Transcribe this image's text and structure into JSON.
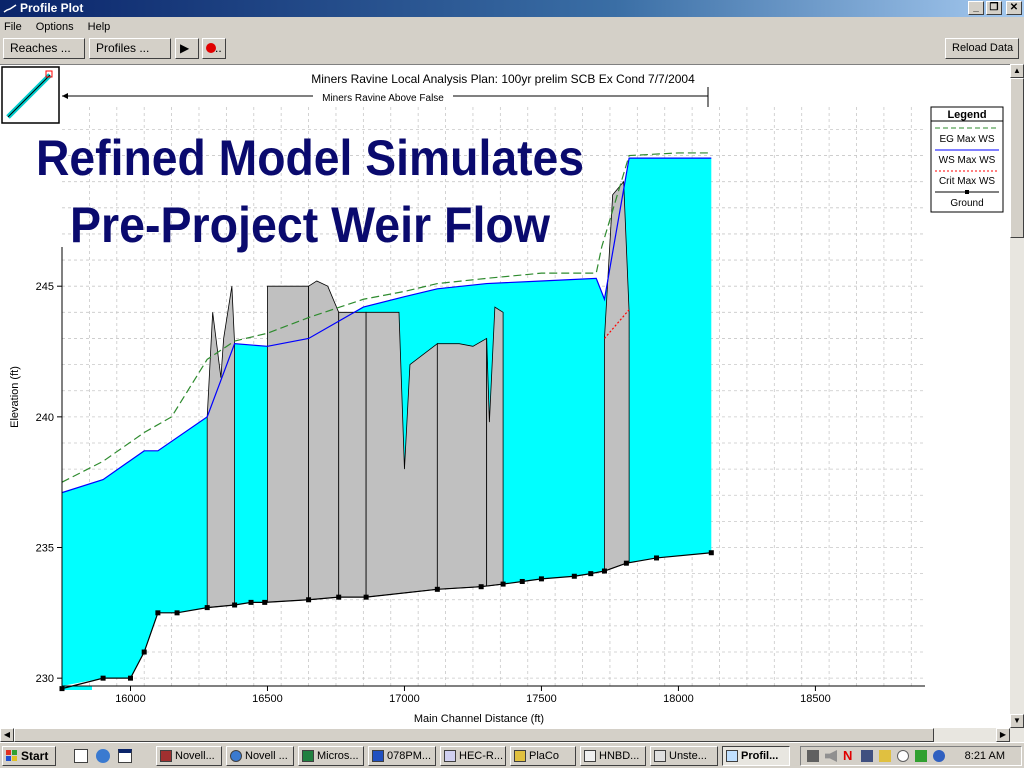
{
  "window": {
    "title": "Profile Plot",
    "minimize_glyph": "_",
    "maximize_glyph": "❐",
    "close_glyph": "✕"
  },
  "menu": {
    "items": [
      "File",
      "Options",
      "Help"
    ]
  },
  "toolbar": {
    "reaches_label": "Reaches ...",
    "profiles_label": "Profiles ...",
    "play_glyph": "▶",
    "more_glyph": "..",
    "reload_label": "Reload Data"
  },
  "plot": {
    "header": "Miners Ravine Local Analysis       Plan: 100yr prelim SCB Ex Cond     7/7/2004",
    "reach_label": "Miners Ravine Above False",
    "overlay_line1": "Refined Model Simulates",
    "overlay_line2": "Pre-Project Weir Flow",
    "overlay_color": "#0a0a6e",
    "water_color": "#00ffff",
    "structure_color": "#c0c0c0"
  },
  "chart_data": {
    "type": "area",
    "xlabel": "Main Channel Distance (ft)",
    "ylabel": "Elevation (ft)",
    "xlim": [
      15750,
      18900
    ],
    "ylim": [
      229.7,
      246.5
    ],
    "x_ticks": [
      16000,
      16500,
      17000,
      17500,
      18000,
      18500
    ],
    "y_ticks": [
      230,
      235,
      240,
      245
    ],
    "grid": true,
    "legend_position": "top-right",
    "legend": {
      "title": "Legend",
      "entries": [
        "EG  Max WS",
        "WS  Max WS",
        "Crit  Max WS",
        "Ground"
      ]
    },
    "series": [
      {
        "name": "EG  Max WS",
        "color": "#2e8b2e",
        "x": [
          15750,
          15900,
          16050,
          16150,
          16280,
          16380,
          16500,
          16650,
          16850,
          17000,
          17120,
          17300,
          17500,
          17700,
          17720,
          17820,
          18000,
          18120
        ],
        "y": [
          237.5,
          238.3,
          239.4,
          240.0,
          242.2,
          242.9,
          243.2,
          243.8,
          244.5,
          244.8,
          245.1,
          245.3,
          245.5,
          245.5,
          246.5,
          250.0,
          250.1,
          250.1
        ]
      },
      {
        "name": "WS  Max WS",
        "color": "#0000ff",
        "x": [
          15750,
          15900,
          16050,
          16100,
          16280,
          16380,
          16500,
          16650,
          16850,
          17000,
          17120,
          17300,
          17500,
          17700,
          17730,
          17820,
          18000,
          18120
        ],
        "y": [
          237.1,
          237.6,
          238.7,
          238.7,
          240.0,
          242.8,
          242.7,
          243.0,
          244.2,
          244.6,
          244.9,
          245.1,
          245.2,
          245.3,
          244.5,
          249.9,
          249.9,
          249.9
        ]
      },
      {
        "name": "Crit  Max WS",
        "color": "#ff0000",
        "x": [
          17730,
          17820
        ],
        "y": [
          243.0,
          244.1
        ]
      },
      {
        "name": "Ground",
        "color": "#000000",
        "x": [
          15750,
          15900,
          16000,
          16050,
          16100,
          16170,
          16280,
          16380,
          16440,
          16490,
          16650,
          16760,
          16860,
          17120,
          17280,
          17360,
          17430,
          17500,
          17620,
          17680,
          17730,
          17810,
          17920,
          18120
        ],
        "y": [
          229.6,
          230.0,
          230.0,
          231.0,
          232.5,
          232.5,
          232.7,
          232.8,
          232.9,
          232.9,
          233.0,
          233.1,
          233.1,
          233.4,
          233.5,
          233.6,
          233.7,
          233.8,
          233.9,
          234.0,
          234.1,
          234.4,
          234.6,
          234.8
        ]
      }
    ],
    "structures": [
      {
        "x": [
          16280,
          16300,
          16330,
          16340,
          16370,
          16380
        ],
        "top": [
          240.0,
          244.0,
          241.5,
          243.0,
          245.0,
          242.8
        ]
      },
      {
        "x": [
          16500,
          16650
        ],
        "top": [
          245.0,
          245.0
        ]
      },
      {
        "x": [
          16650,
          16680,
          16720,
          16760
        ],
        "top": [
          245.0,
          245.2,
          245.0,
          244.0
        ]
      },
      {
        "x": [
          16760,
          16860
        ],
        "top": [
          244.0,
          244.0
        ]
      },
      {
        "x": [
          16860,
          16980,
          17000,
          17020,
          17120
        ],
        "top": [
          244.0,
          244.0,
          238.0,
          242.0,
          242.8
        ]
      },
      {
        "x": [
          17120,
          17200,
          17250,
          17300
        ],
        "top": [
          242.8,
          242.8,
          242.7,
          243.0
        ]
      },
      {
        "x": [
          17300,
          17310,
          17330,
          17360
        ],
        "top": [
          243.0,
          239.8,
          244.2,
          244.0
        ]
      },
      {
        "x": [
          17730,
          17760,
          17800,
          17820
        ],
        "top": [
          243.0,
          248.5,
          249.0,
          244.0
        ]
      }
    ]
  },
  "taskbar": {
    "start_label": "Start",
    "tasks": [
      "Novell...",
      "Novell ...",
      "Micros...",
      "078PM...",
      "HEC-R...",
      "PlaCo",
      "HNBD...",
      "Unste...",
      "Profil..."
    ],
    "clock": "8:21 AM"
  }
}
